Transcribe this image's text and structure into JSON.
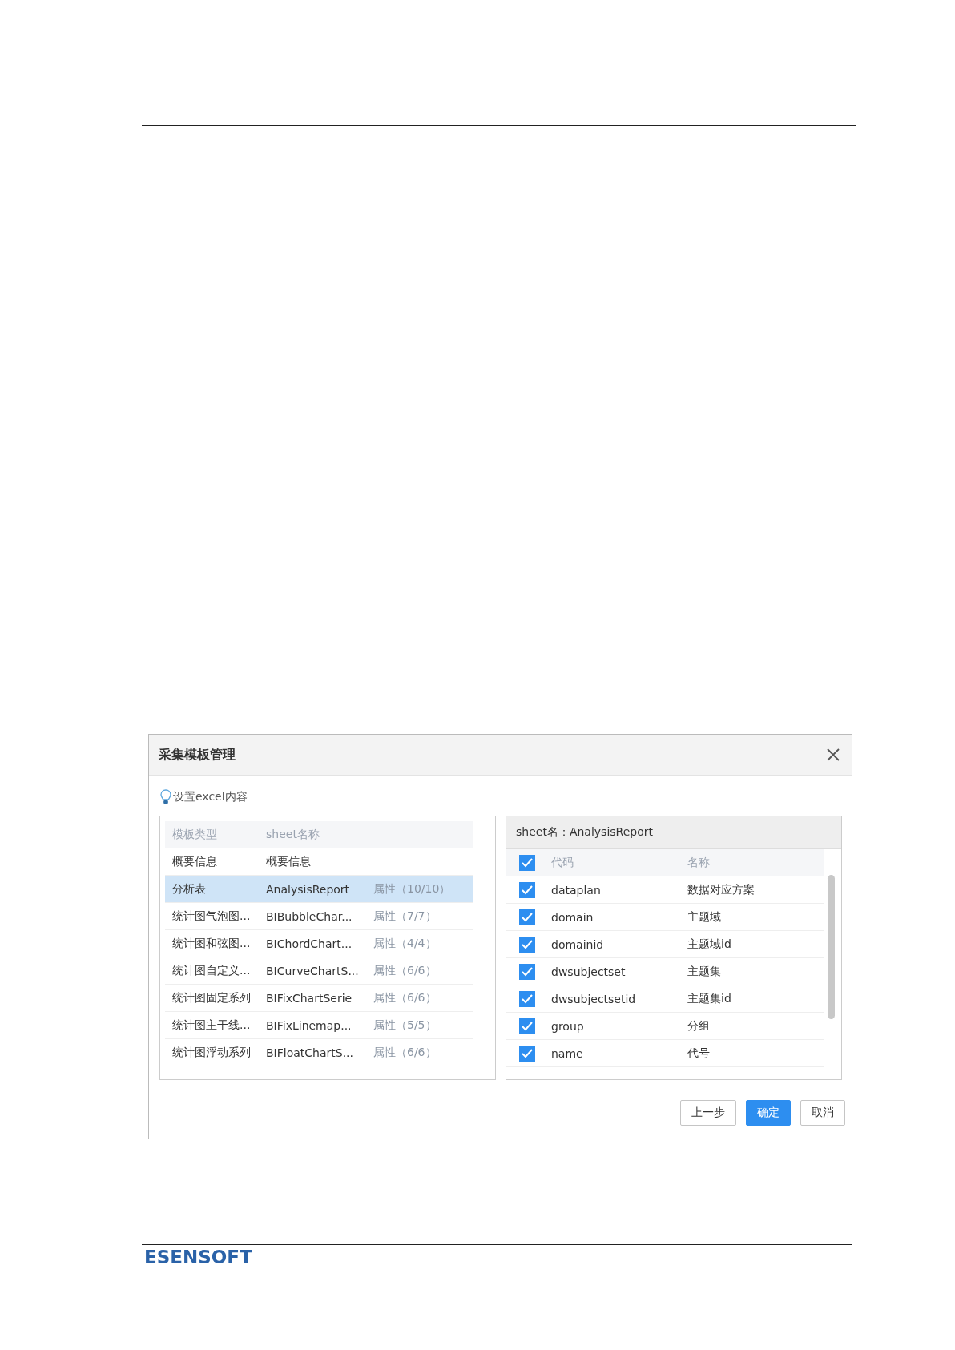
{
  "dialog": {
    "title": "采集模板管理",
    "hint": "设置excel内容",
    "template_table": {
      "columns": [
        "模板类型",
        "sheet名称"
      ],
      "rows": [
        {
          "type": "概要信息",
          "sheet": "概要信息",
          "attributes": "",
          "selected": false
        },
        {
          "type": "分析表",
          "sheet": "AnalysisReport",
          "attributes": "属性（10/10）",
          "selected": true
        },
        {
          "type": "统计图气泡图...",
          "sheet": "BIBubbleChar...",
          "attributes": "属性（7/7）",
          "selected": false
        },
        {
          "type": "统计图和弦图...",
          "sheet": "BIChordChart...",
          "attributes": "属性（4/4）",
          "selected": false
        },
        {
          "type": "统计图自定义...",
          "sheet": "BICurveChartS...",
          "attributes": "属性（6/6）",
          "selected": false
        },
        {
          "type": "统计图固定系列",
          "sheet": "BIFixChartSerie",
          "attributes": "属性（6/6）",
          "selected": false
        },
        {
          "type": "统计图主干线...",
          "sheet": "BIFixLinemap...",
          "attributes": "属性（5/5）",
          "selected": false
        },
        {
          "type": "统计图浮动系列",
          "sheet": "BIFloatChartS...",
          "attributes": "属性（6/6）",
          "selected": false
        }
      ]
    },
    "field_table": {
      "title": "sheet名：AnalysisReport",
      "header_checked": true,
      "columns": [
        "代码",
        "名称"
      ],
      "rows": [
        {
          "code": "dataplan",
          "name": "数据对应方案",
          "checked": true
        },
        {
          "code": "domain",
          "name": "主题域",
          "checked": true
        },
        {
          "code": "domainid",
          "name": "主题域id",
          "checked": true
        },
        {
          "code": "dwsubjectset",
          "name": "主题集",
          "checked": true
        },
        {
          "code": "dwsubjectsetid",
          "name": "主题集id",
          "checked": true
        },
        {
          "code": "group",
          "name": "分组",
          "checked": true
        },
        {
          "code": "name",
          "name": "代号",
          "checked": true
        }
      ]
    },
    "buttons": [
      {
        "label": "上一步",
        "kind": "default"
      },
      {
        "label": "确定",
        "kind": "primary"
      },
      {
        "label": "取消",
        "kind": "default"
      }
    ]
  },
  "footer": {
    "logo": "ESENSOFT"
  }
}
